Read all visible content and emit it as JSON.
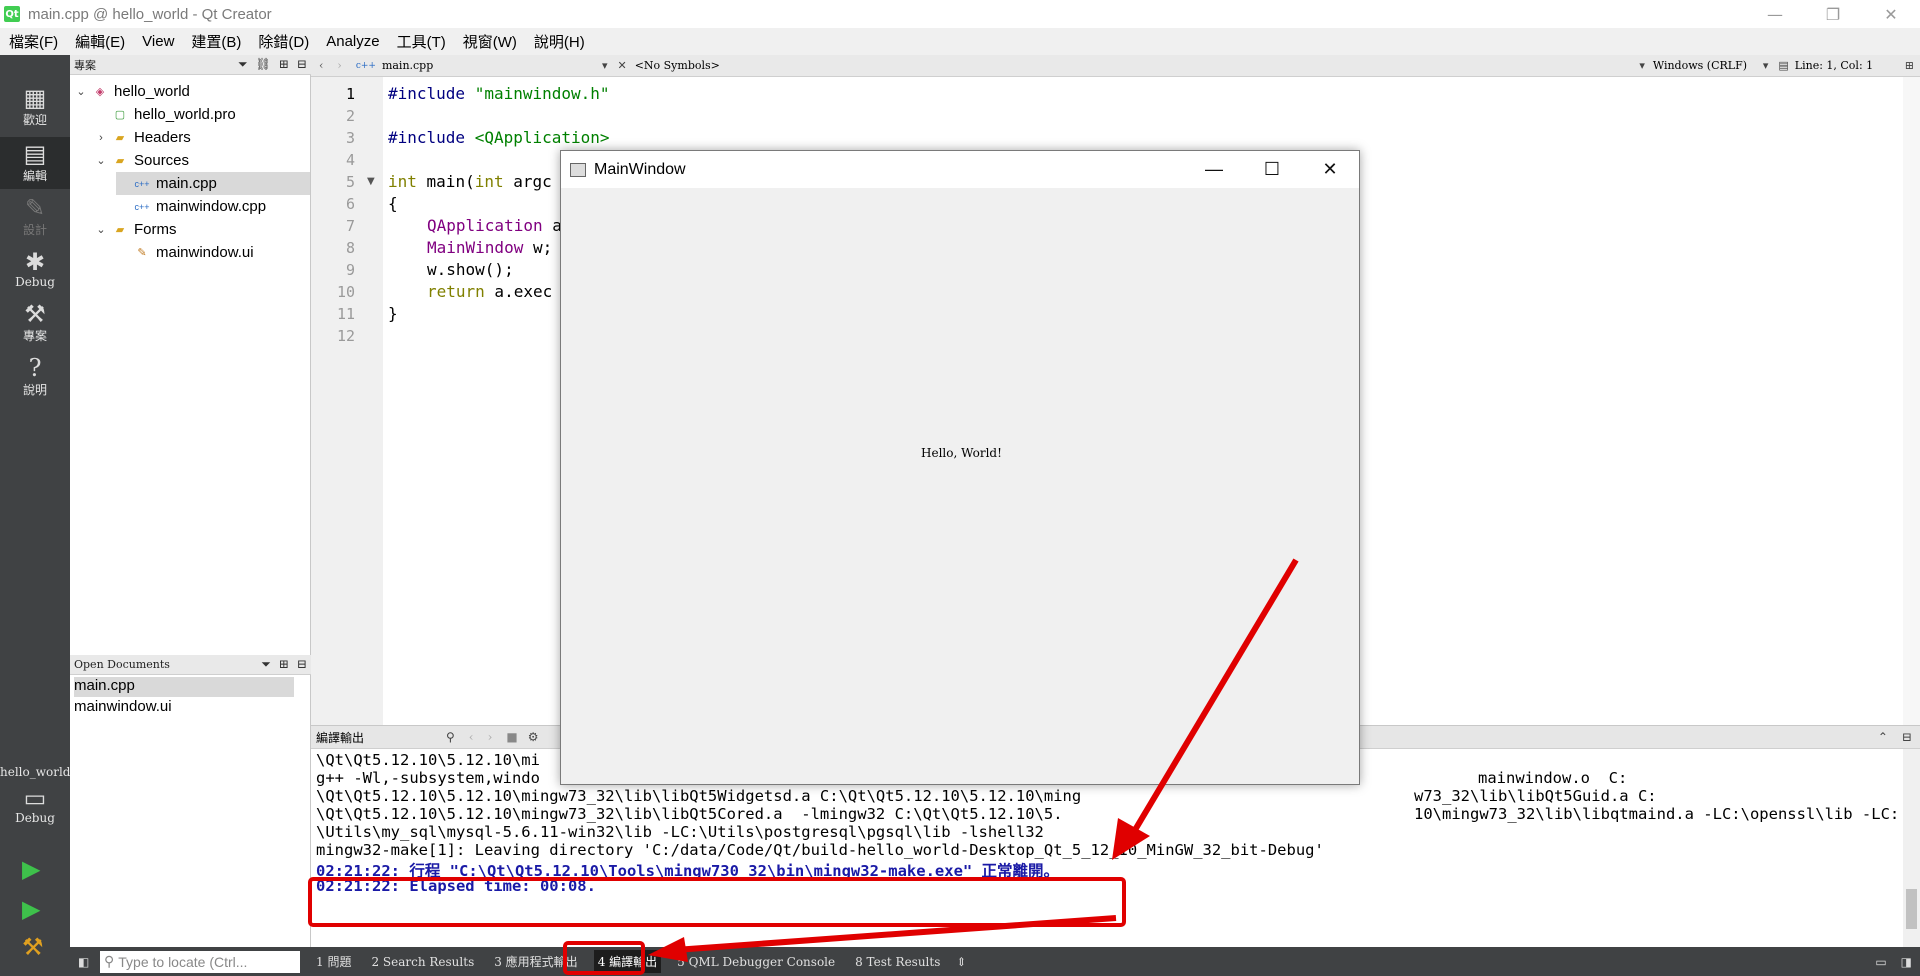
{
  "window": {
    "title": "main.cpp @ hello_world - Qt Creator",
    "app_logo": "Qt",
    "controls": [
      "—",
      "❐",
      "✕"
    ]
  },
  "menu": [
    "檔案(F)",
    "編輯(E)",
    "View",
    "建置(B)",
    "除錯(D)",
    "Analyze",
    "工具(T)",
    "視窗(W)",
    "說明(H)"
  ],
  "modes": {
    "welcome": "歡迎",
    "edit": "編輯",
    "design": "設計",
    "debug": "Debug",
    "projects": "專案",
    "help": "說明"
  },
  "kit": {
    "project": "hello_world",
    "mode": "Debug"
  },
  "sidebar": {
    "header": "專案",
    "tree": [
      {
        "label": "hello_world",
        "arrow": "⌄",
        "icon": "project-icon"
      },
      {
        "label": "hello_world.pro",
        "arrow": "",
        "icon": "pro-file-icon"
      },
      {
        "label": "Headers",
        "arrow": "›",
        "icon": "folder-icon"
      },
      {
        "label": "Sources",
        "arrow": "⌄",
        "icon": "folder-icon"
      },
      {
        "label": "main.cpp",
        "arrow": "",
        "icon": "cpp-file-icon"
      },
      {
        "label": "mainwindow.cpp",
        "arrow": "",
        "icon": "cpp-file-icon"
      },
      {
        "label": "Forms",
        "arrow": "⌄",
        "icon": "folder-icon"
      },
      {
        "label": "mainwindow.ui",
        "arrow": "",
        "icon": "ui-file-icon"
      }
    ],
    "open_docs_header": "Open Documents",
    "open_docs": [
      "main.cpp",
      "mainwindow.ui"
    ]
  },
  "editor_toolbar": {
    "file": "main.cpp",
    "symbols": "<No Symbols>",
    "line_endings": "Windows (CRLF)",
    "position": "Line: 1, Col: 1"
  },
  "code": {
    "line_numbers": [
      "1",
      "2",
      "3",
      "4",
      "5",
      "6",
      "7",
      "8",
      "9",
      "10",
      "11",
      "12"
    ],
    "l1_pp": "#include ",
    "l1_str": "\"mainwindow.h\"",
    "l3_pp": "#include ",
    "l3_str": "<QApplication>",
    "l5_kw": "int",
    "l5_rest": " main(",
    "l5_kw2": "int",
    "l5_rest2": " argc",
    "l6": "{",
    "l7_ty": "QApplication",
    "l7_rest": " a",
    "l8_ty": "MainWindow",
    "l8_rest": " w;",
    "l9": "w.show();",
    "l10_kw": "return",
    "l10_rest": " a.exec",
    "l11": "}"
  },
  "output": {
    "header": "編譯輸出",
    "lines": [
      "\\Qt\\Qt5.12.10\\5.12.10\\mi",
      "g++ -Wl,-subsystem,windo",
      "\\Qt\\Qt5.12.10\\5.12.10\\mingw73_32\\lib\\libQt5Widgetsd.a C:\\Qt\\Qt5.12.10\\5.12.10\\ming",
      "\\Qt\\Qt5.12.10\\5.12.10\\mingw73_32\\lib\\libQt5Cored.a  -lmingw32 C:\\Qt\\Qt5.12.10\\5.",
      "\\Utils\\my_sql\\mysql-5.6.11-win32\\lib -LC:\\Utils\\postgresql\\pgsql\\lib -lshell32",
      "mingw32-make[1]: Leaving directory 'C:/data/Code/Qt/build-hello_world-Desktop_Qt_5_12_10_MinGW_32_bit-Debug'",
      "02:21:22: 行程 \"C:\\Qt\\Qt5.12.10\\Tools\\mingw730_32\\bin\\mingw32-make.exe\" 正常離開。",
      "02:21:22: Elapsed time: 00:08."
    ],
    "line2_tail": "mainwindow.o  C:",
    "line3_tail": "w73_32\\lib\\libQt5Guid.a C:",
    "line4_tail": "10\\mingw73_32\\lib\\libqtmaind.a -LC:\\openssl\\lib -LC:"
  },
  "statusbar": {
    "locator_placeholder": "Type to locate (Ctrl...",
    "tabs": [
      "1  問題",
      "2  Search Results",
      "3  應用程式輸出",
      "4  編譯輸出",
      "5  QML Debugger Console",
      "8  Test Results"
    ]
  },
  "popup": {
    "title": "MainWindow",
    "label": "Hello, World!"
  },
  "colors": {
    "annotation": "#e00000",
    "modebar": "#404244",
    "output_highlight": "#1a1aa6"
  }
}
